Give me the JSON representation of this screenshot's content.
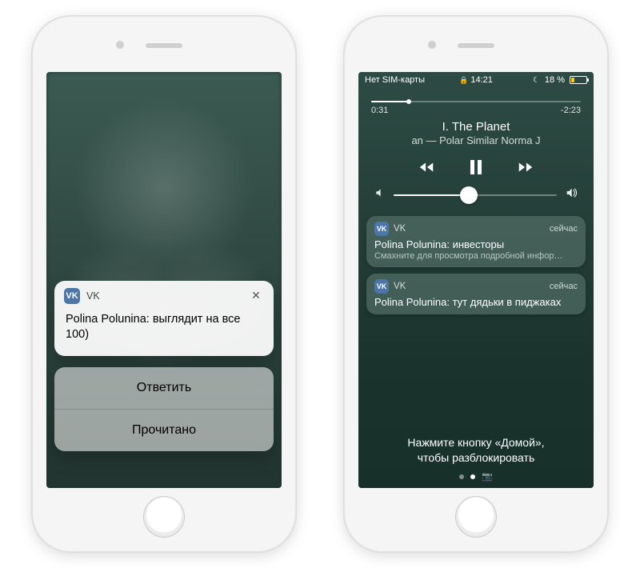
{
  "phone1": {
    "notification": {
      "app_name": "VK",
      "sender": "Polina Polunina",
      "message": "Polina Polunina: выглядит на все 100)"
    },
    "actions": {
      "reply": "Ответить",
      "mark_read": "Прочитано"
    }
  },
  "phone2": {
    "status_bar": {
      "carrier": "Нет SIM-карты",
      "time": "14:21",
      "battery_percent": "18 %"
    },
    "media": {
      "elapsed": "0:31",
      "remaining": "-2:23",
      "track_title": "I. The Planet",
      "track_artist_line": "an — Polar Similar      Norma J"
    },
    "notifications": [
      {
        "app_name": "VK",
        "time_label": "сейчас",
        "message": "Polina Polunina: инвесторы",
        "hint": "Смахните для просмотра подробной инфор…"
      },
      {
        "app_name": "VK",
        "time_label": "сейчас",
        "message": "Polina Polunina: тут дядьки в пиджаках"
      }
    ],
    "unlock_hint_line1": "Нажмите кнопку «Домой»,",
    "unlock_hint_line2": "чтобы разблокировать"
  }
}
